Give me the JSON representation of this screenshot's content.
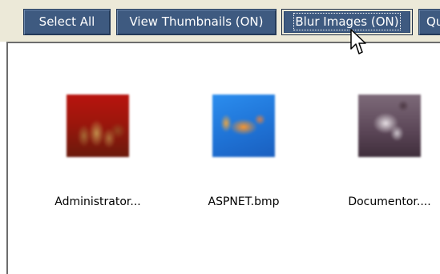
{
  "toolbar": {
    "buttons": [
      {
        "label": "Select All"
      },
      {
        "label": "View Thumbnails (ON)"
      },
      {
        "label": "Blur Images (ON)"
      },
      {
        "label": "Qu"
      }
    ]
  },
  "files": [
    {
      "name": "Administrator...",
      "thumbnail": "blurred-red-figures-thumbnail"
    },
    {
      "name": "ASPNET.bmp",
      "thumbnail": "blurred-orange-fish-thumbnail"
    },
    {
      "name": "Documentor....",
      "thumbnail": "blurred-martial-arts-thumbnail"
    }
  ],
  "colors": {
    "button_bg": "#3e5a80",
    "toolbar_bg": "#ece9d8",
    "panel_bg": "#ffffff"
  },
  "icons": {
    "cursor": "mouse-pointer-icon"
  }
}
